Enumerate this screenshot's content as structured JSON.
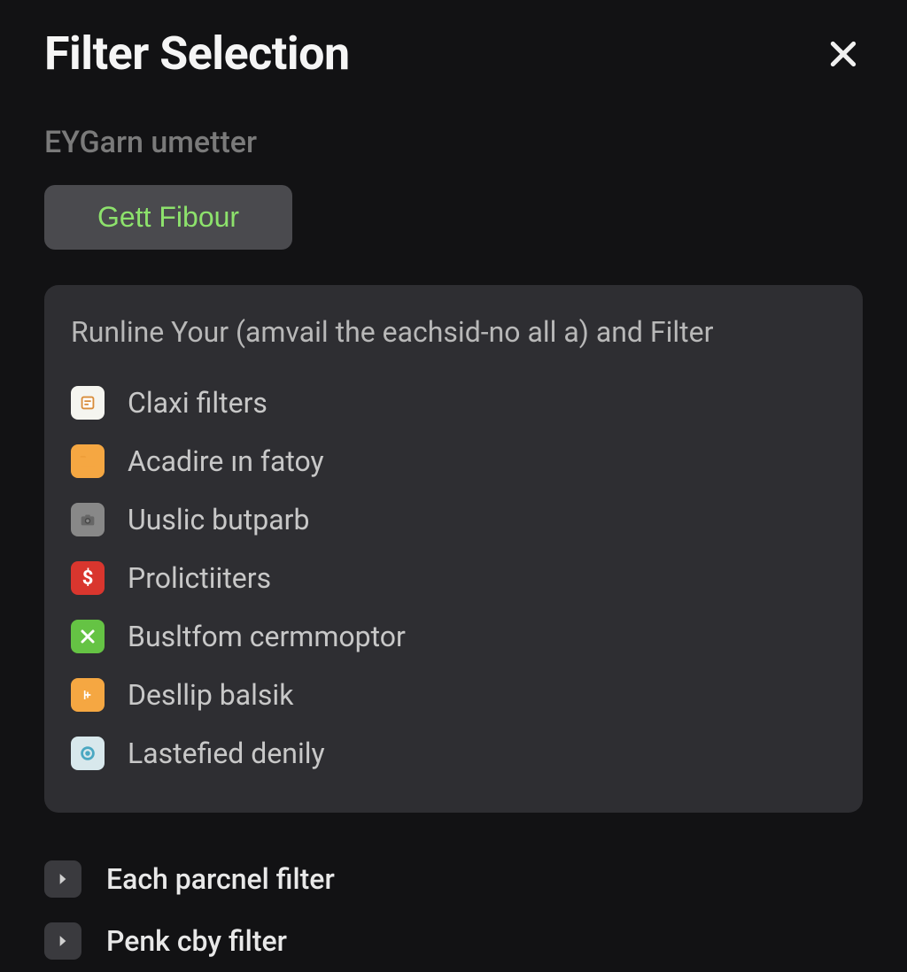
{
  "header": {
    "title": "Filter Selection"
  },
  "subtitle": "EYGarn umetter",
  "primary_button": "Gett Fibour",
  "panel": {
    "heading": "Runline Your (amvail the eachsid-no all a) and Filter",
    "items": [
      {
        "label": "Claxi filters",
        "icon": "note"
      },
      {
        "label": "Acadire ın fatoy",
        "icon": "folder"
      },
      {
        "label": "Uuslic butparb",
        "icon": "camera"
      },
      {
        "label": "Prolictiiters",
        "icon": "dollar"
      },
      {
        "label": "Busltfom cermmoptor",
        "icon": "check"
      },
      {
        "label": "Desllip balsik",
        "icon": "scissors"
      },
      {
        "label": "Lastefied denily",
        "icon": "circle"
      }
    ]
  },
  "expandable": [
    {
      "label": "Each parcnel filter"
    },
    {
      "label": "Penk cby filter"
    }
  ]
}
